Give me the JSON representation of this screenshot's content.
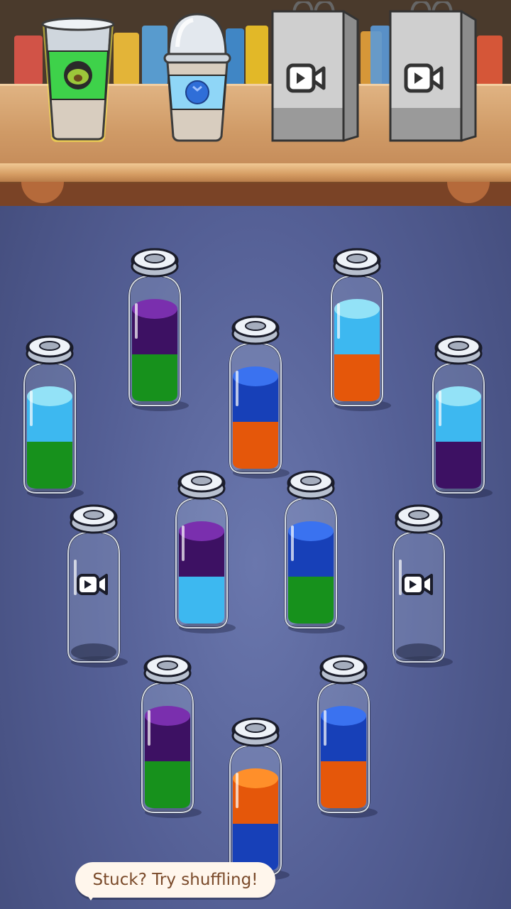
{
  "colors": {
    "purple": [
      "#7a2fae",
      "#3d1163"
    ],
    "green": [
      "#2ec632",
      "#17911c"
    ],
    "light_blue": [
      "#93e2f7",
      "#3db8f0"
    ],
    "blue": [
      "#3a72f0",
      "#1740b8"
    ],
    "orange": [
      "#ff8f2a",
      "#e5570a"
    ]
  },
  "cups": [
    {
      "name": "cup-avocado",
      "band": "#3ed24a",
      "icon": "avocado-icon",
      "icon_color": "#5a8a2a",
      "lid": false,
      "selected": true
    },
    {
      "name": "cup-blueberry",
      "band": "#8fd6f7",
      "icon": "blueberry-icon",
      "icon_color": "#2f6ed8",
      "lid": true,
      "selected": false
    }
  ],
  "locked_bags": [
    {
      "name": "locked-bag-1",
      "icon": "video-ad-icon"
    },
    {
      "name": "locked-bag-2",
      "icon": "video-ad-icon"
    }
  ],
  "bottles": [
    {
      "id": "b1",
      "layers": [
        "green",
        "purple"
      ],
      "locked": false
    },
    {
      "id": "b2",
      "layers": [
        "orange",
        "light_blue"
      ],
      "locked": false
    },
    {
      "id": "b3",
      "layers": [
        "green",
        "light_blue"
      ],
      "locked": false
    },
    {
      "id": "b4",
      "layers": [
        "orange",
        "blue"
      ],
      "locked": false
    },
    {
      "id": "b5",
      "layers": [
        "light_blue",
        "purple"
      ],
      "locked": false
    },
    {
      "id": "b6",
      "layers": [],
      "locked": true
    },
    {
      "id": "b7",
      "layers": [
        "purple",
        "light_blue"
      ],
      "locked": false
    },
    {
      "id": "b8",
      "layers": [
        "green",
        "blue"
      ],
      "locked": false
    },
    {
      "id": "b9",
      "layers": [],
      "locked": true
    },
    {
      "id": "b10",
      "layers": [
        "green",
        "purple"
      ],
      "locked": false
    },
    {
      "id": "b11",
      "layers": [
        "blue",
        "orange"
      ],
      "locked": false
    },
    {
      "id": "b12",
      "layers": [
        "orange",
        "blue"
      ],
      "locked": false
    }
  ],
  "hint": {
    "text": "Stuck? Try shuffling!"
  }
}
